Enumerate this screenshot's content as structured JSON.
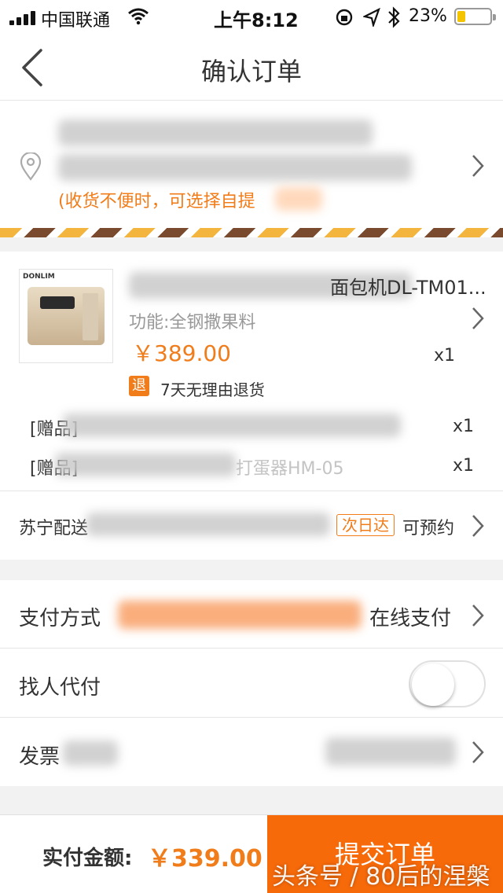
{
  "status_bar": {
    "carrier": "中国联通",
    "time": "上午8:12",
    "battery_percent": "23%"
  },
  "nav": {
    "title": "确认订单"
  },
  "address": {
    "hint": "(收货不便时，可选择自提"
  },
  "product": {
    "name_suffix": "面包机DL-TM01...",
    "spec": "功能:全钢撒果料",
    "price": "￥389.00",
    "quantity": "x1",
    "return_tag": "退",
    "return_policy": "7天无理由退货",
    "gifts": [
      {
        "label": "[赠品]",
        "quantity": "x1"
      },
      {
        "label": "[赠品]",
        "name_partial": "打蛋器HM-05",
        "quantity": "x1"
      }
    ],
    "shipping_label": "苏宁配送",
    "shipping_tag": "次日达",
    "shipping_action": "可预约"
  },
  "options": {
    "payment_label": "支付方式",
    "payment_value": "在线支付",
    "proxy_pay_label": "找人代付",
    "invoice_label": "发票"
  },
  "footer": {
    "total_label": "实付金额:",
    "total_amount": "￥339.00",
    "submit_label": "提交订单",
    "watermark": "头条号 / 80后的涅槃"
  },
  "colors": {
    "accent": "#f07c1a",
    "submit_bg": "#f76a0a"
  }
}
